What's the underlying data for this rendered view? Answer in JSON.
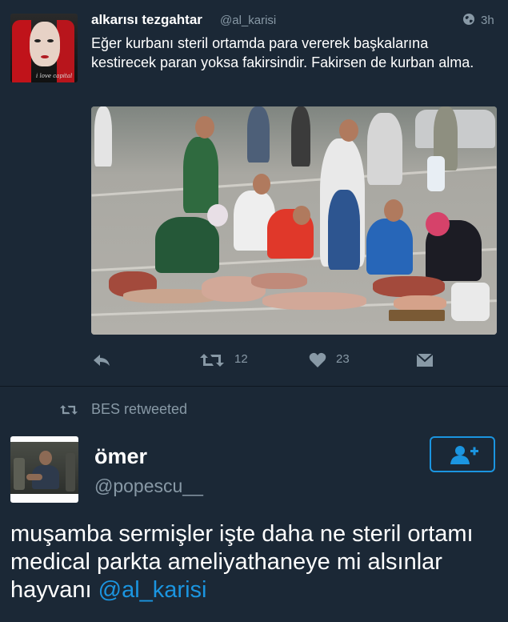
{
  "tweet1": {
    "author_name": "alkarısı tezgahtar",
    "handle": "@al_karisi",
    "time": "3h",
    "text": "Eğer kurbanı steril ortamda para vererek başkalarına kestirecek paran yoksa fakirsindir. Fakirsen de kurban alma.",
    "avatar_signature": "i love capital",
    "retweet_count": "12",
    "like_count": "23",
    "icons": [
      "globe-icon",
      "reply-icon",
      "retweet-icon",
      "heart-icon",
      "dm-icon"
    ]
  },
  "retweet_banner": {
    "label": "BES retweeted"
  },
  "tweet2": {
    "author_name": "ömer",
    "handle": "@popescu__",
    "text_before_mention": "muşamba sermişler işte daha ne steril ortamı medical parkta ameliyathaneye mi alsınlar hayvanı ",
    "mention": "@al_karisi",
    "follow_icon": "add-user-icon"
  },
  "colors": {
    "background": "#1b2836",
    "secondary_text": "#8899a6",
    "accent": "#1b95e0",
    "primary_text": "#ffffff"
  }
}
